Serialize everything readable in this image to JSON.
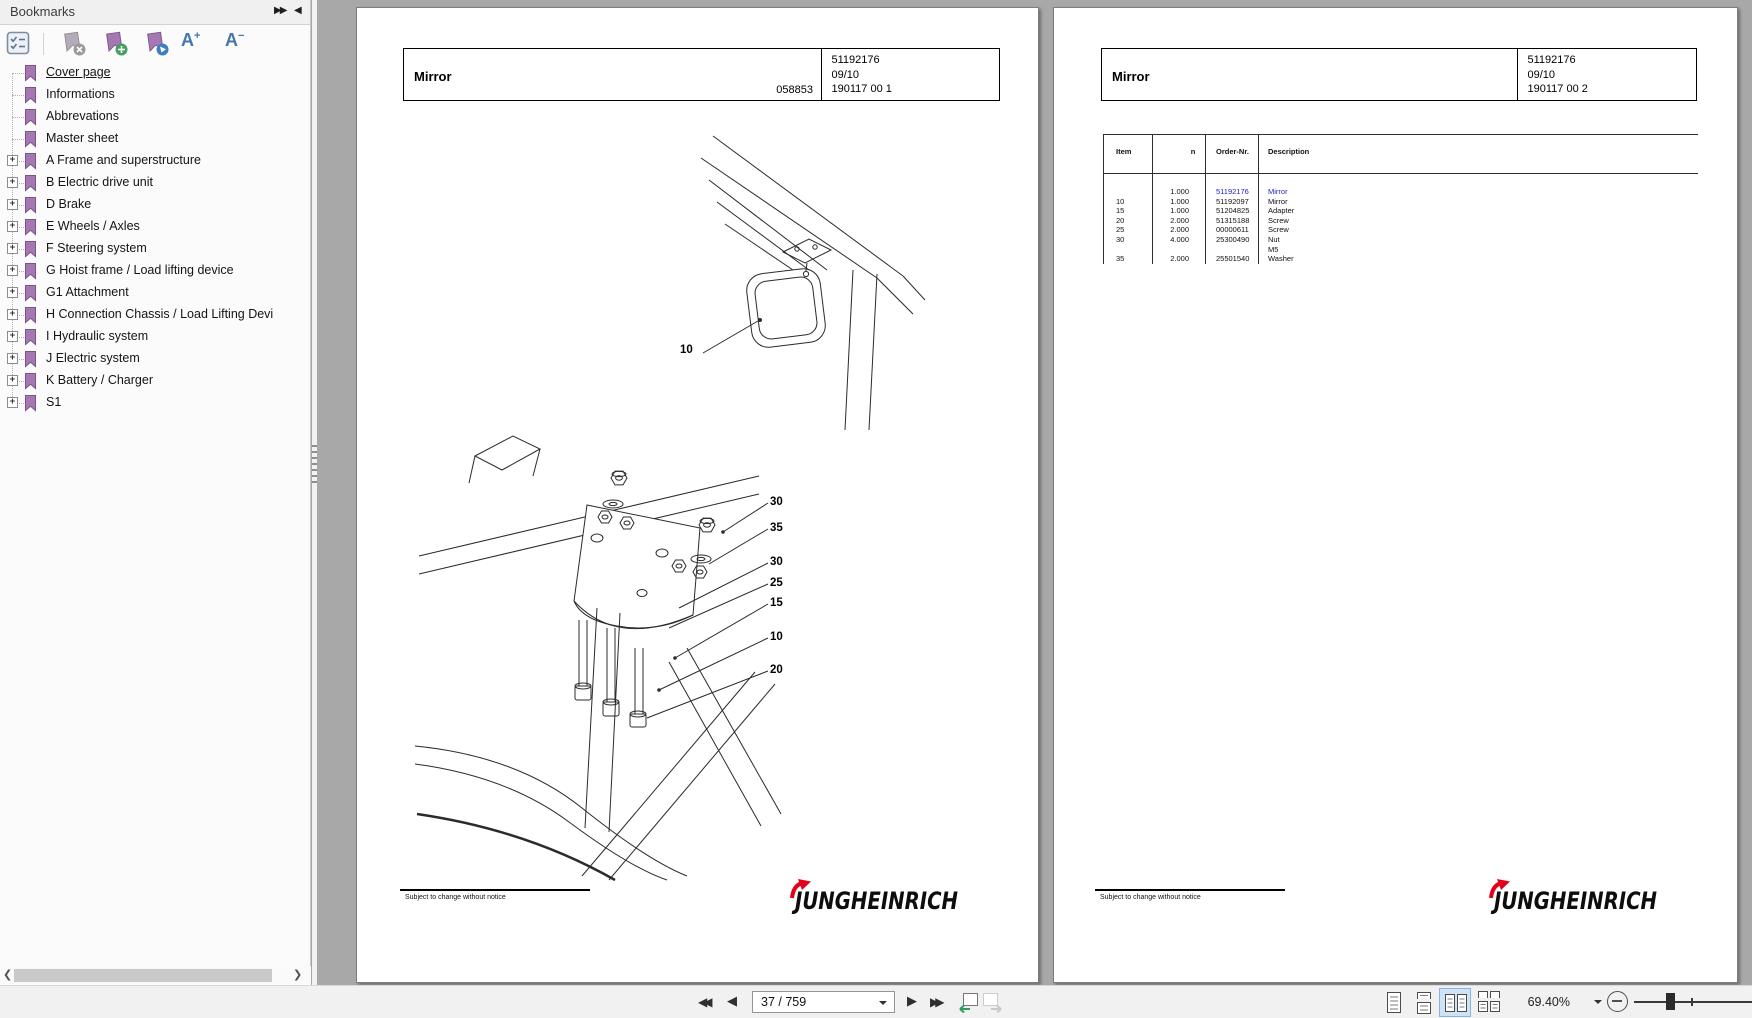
{
  "sidebar": {
    "title": "Bookmarks",
    "items": [
      {
        "label": "Cover page",
        "expandable": false,
        "selected": true
      },
      {
        "label": "Informations",
        "expandable": false
      },
      {
        "label": "Abbrevations",
        "expandable": false
      },
      {
        "label": "Master sheet",
        "expandable": false
      },
      {
        "label": "A Frame and superstructure",
        "expandable": true
      },
      {
        "label": "B Electric drive unit",
        "expandable": true
      },
      {
        "label": "D Brake",
        "expandable": true
      },
      {
        "label": "E Wheels / Axles",
        "expandable": true
      },
      {
        "label": "F Steering system",
        "expandable": true
      },
      {
        "label": "G Hoist frame / Load lifting device",
        "expandable": true
      },
      {
        "label": "G1 Attachment",
        "expandable": true
      },
      {
        "label": "H Connection Chassis / Load Lifting Devi",
        "expandable": true
      },
      {
        "label": "I Hydraulic system",
        "expandable": true
      },
      {
        "label": "J Electric system",
        "expandable": true
      },
      {
        "label": "K Battery / Charger",
        "expandable": true
      },
      {
        "label": "S1",
        "expandable": true
      }
    ]
  },
  "pages": {
    "left": {
      "header": {
        "title": "Mirror",
        "sheet_code": "058853",
        "part_number": "51192176",
        "revision": "09/10",
        "doc_number": "190117 00 1"
      },
      "upper_callouts": [
        "10"
      ],
      "lower_callouts": [
        "30",
        "35",
        "30",
        "25",
        "15",
        "10",
        "20"
      ],
      "footer_note": "Subject to change without notice",
      "brand": "JUNGHEINRICH"
    },
    "right": {
      "header": {
        "title": "Mirror",
        "part_number": "51192176",
        "revision": "09/10",
        "doc_number": "190117 00 2"
      },
      "table": {
        "columns": [
          "Item",
          "n",
          "Order-Nr.",
          "Description"
        ],
        "rows": [
          {
            "item": "",
            "n": "1.000",
            "order": "51192176",
            "description": "Mirror",
            "link": true
          },
          {
            "item": "10",
            "n": "1.000",
            "order": "51192097",
            "description": "Mirror",
            "link": false
          },
          {
            "item": "15",
            "n": "1.000",
            "order": "51204825",
            "description": "Adapter",
            "link": false
          },
          {
            "item": "20",
            "n": "2.000",
            "order": "51315188",
            "description": "Screw",
            "link": false
          },
          {
            "item": "25",
            "n": "2.000",
            "order": "00000611",
            "description": "Screw",
            "link": false
          },
          {
            "item": "30",
            "n": "4.000",
            "order": "25300490",
            "description": "Nut",
            "link": false
          },
          {
            "item": "",
            "n": "",
            "order": "",
            "description": "M5",
            "link": false
          },
          {
            "item": "35",
            "n": "2.000",
            "order": "25501540",
            "description": "Washer",
            "link": false
          }
        ]
      },
      "footer_note": "Subject to change without notice",
      "brand": "JUNGHEINRICH"
    }
  },
  "toolbar": {
    "page_field": "37 / 759",
    "zoom_value": "69.40%"
  },
  "colors": {
    "link_blue": "#2222cc",
    "bookmark_purple": "#a678b2",
    "brand_red": "#e2001a",
    "selected_layout_bg": "#cfe3f7",
    "doc_background": "#a8a8a8"
  }
}
